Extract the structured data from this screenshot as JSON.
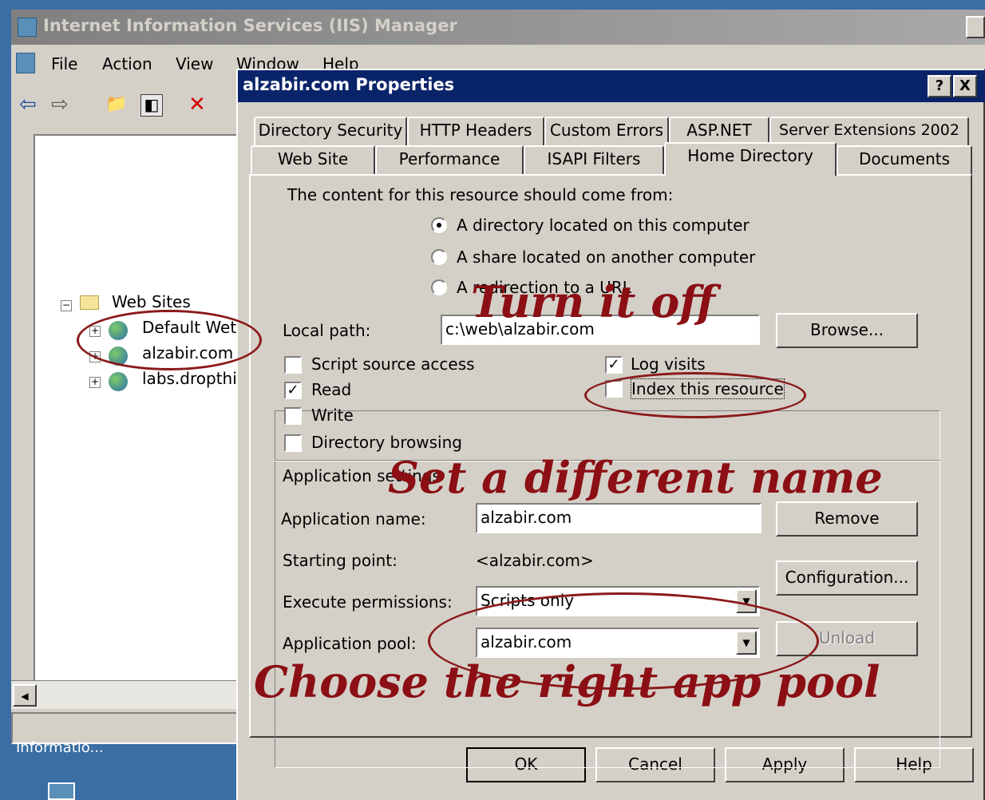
{
  "window": {
    "title": "Internet Information Services (IIS) Manager"
  },
  "menu": {
    "items": [
      "File",
      "Action",
      "View",
      "Window",
      "Help"
    ]
  },
  "tree": {
    "root": "Web Sites",
    "sites": [
      "Default Wet",
      "alzabir.com",
      "labs.dropthi"
    ]
  },
  "desktop": {
    "label": "Informatio..."
  },
  "dialog": {
    "title": "alzabir.com Properties",
    "help_button": "?",
    "close_button": "X",
    "tabs_row1": [
      "Directory Security",
      "HTTP Headers",
      "Custom Errors",
      "ASP.NET",
      "Server Extensions 2002"
    ],
    "tabs_row2": [
      "Web Site",
      "Performance",
      "ISAPI Filters",
      "Home Directory",
      "Documents"
    ],
    "active_tab": "Home Directory",
    "content_source_label": "The content for this resource should come from:",
    "content_options": [
      {
        "label": "A directory located on this computer",
        "selected": true
      },
      {
        "label": "A share located on another computer",
        "selected": false
      },
      {
        "label": "A redirection to a URL",
        "selected": false
      }
    ],
    "local_path_label": "Local path:",
    "local_path_value": "c:\\web\\alzabir.com",
    "browse_button": "Browse...",
    "checkboxes_left": [
      {
        "label": "Script source access",
        "checked": false
      },
      {
        "label": "Read",
        "checked": true
      },
      {
        "label": "Write",
        "checked": false
      },
      {
        "label": "Directory browsing",
        "checked": false
      }
    ],
    "checkboxes_right": [
      {
        "label": "Log visits",
        "checked": true
      },
      {
        "label": "Index this resource",
        "checked": false
      }
    ],
    "app_settings_label": "Application settings",
    "app_name_label": "Application name:",
    "app_name_value": "alzabir.com",
    "remove_button": "Remove",
    "starting_point_label": "Starting point:",
    "starting_point_value": "<alzabir.com>",
    "configuration_button": "Configuration...",
    "exec_permissions_label": "Execute permissions:",
    "exec_permissions_value": "Scripts only",
    "app_pool_label": "Application pool:",
    "app_pool_value": "alzabir.com",
    "unload_button": "Unload",
    "ok_button": "OK",
    "cancel_button": "Cancel",
    "apply_button": "Apply",
    "help_text_button": "Help"
  },
  "annotations": {
    "turn_off": "Turn it off",
    "different_name": "Set a different name",
    "app_pool": "Choose the right app pool",
    "color": "#8b0f14"
  }
}
